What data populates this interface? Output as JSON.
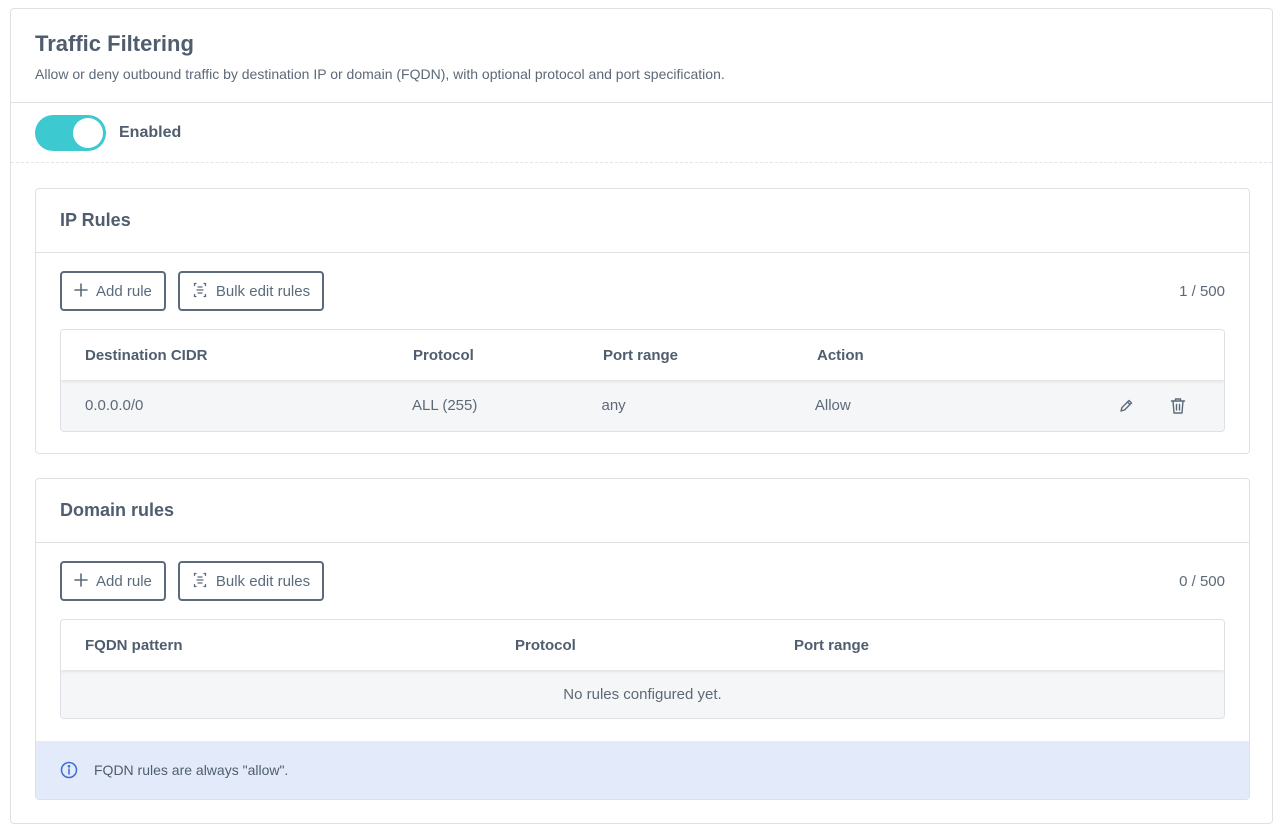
{
  "header": {
    "title": "Traffic Filtering",
    "subtitle": "Allow or deny outbound traffic by destination IP or domain (FQDN), with optional protocol and port specification."
  },
  "toggle": {
    "label": "Enabled",
    "state": "on",
    "color": "#3cc9cf"
  },
  "ip_rules": {
    "title": "IP Rules",
    "add_label": "Add rule",
    "bulk_label": "Bulk edit rules",
    "count": "1 / 500",
    "columns": [
      "Destination CIDR",
      "Protocol",
      "Port range",
      "Action"
    ],
    "rows": [
      {
        "cidr": "0.0.0.0/0",
        "protocol": "ALL (255)",
        "port_range": "any",
        "action": "Allow"
      }
    ]
  },
  "domain_rules": {
    "title": "Domain rules",
    "add_label": "Add rule",
    "bulk_label": "Bulk edit rules",
    "count": "0 / 500",
    "columns": [
      "FQDN pattern",
      "Protocol",
      "Port range"
    ],
    "empty_text": "No rules configured yet.",
    "info_text": "FQDN rules are always \"allow\"."
  },
  "icons": {
    "add": "plus-icon",
    "bulk": "bulk-edit-icon",
    "edit": "pencil-icon",
    "delete": "trash-icon",
    "info": "info-icon"
  }
}
